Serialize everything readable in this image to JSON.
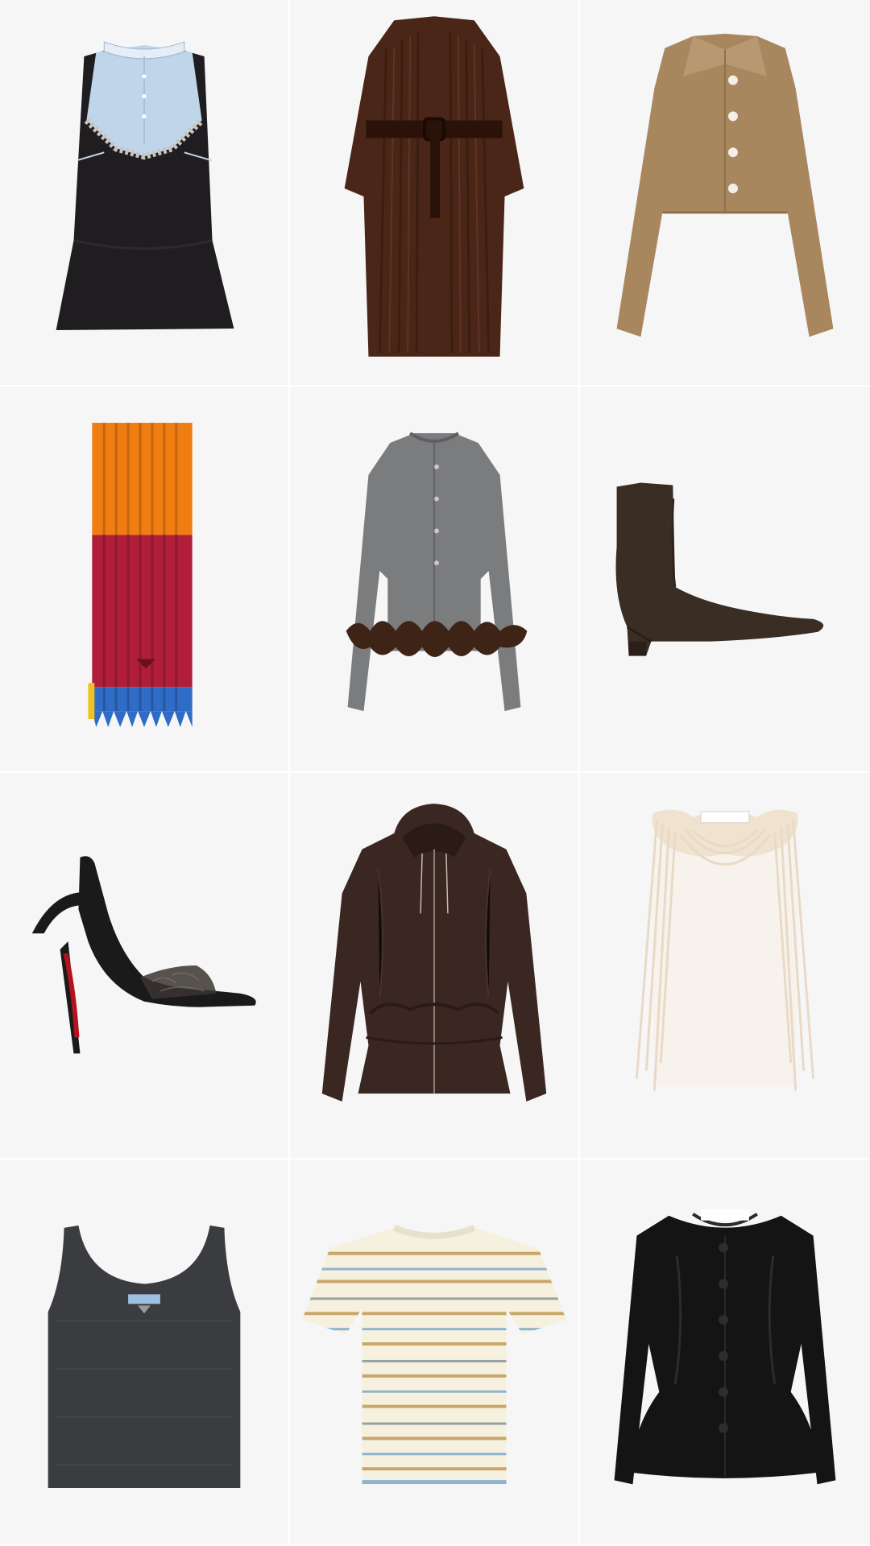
{
  "products": [
    {
      "name": "dress-icon",
      "kind": "dress"
    },
    {
      "name": "fur-coat-icon",
      "kind": "coat"
    },
    {
      "name": "cropped-jacket-icon",
      "kind": "jacket"
    },
    {
      "name": "knit-scarf-icon",
      "kind": "scarf"
    },
    {
      "name": "cardigan-icon",
      "kind": "cardigan"
    },
    {
      "name": "ankle-boot-icon",
      "kind": "boot"
    },
    {
      "name": "heeled-sandal-icon",
      "kind": "sandal"
    },
    {
      "name": "leather-hooded-jacket-icon",
      "kind": "hoodie"
    },
    {
      "name": "fringe-top-icon",
      "kind": "fringe-top"
    },
    {
      "name": "tank-top-icon",
      "kind": "tank"
    },
    {
      "name": "striped-tshirt-icon",
      "kind": "tshirt"
    },
    {
      "name": "leather-peplum-jacket-icon",
      "kind": "peplum-jacket"
    }
  ],
  "colors": {
    "tile_bg": "#f6f6f7",
    "divider": "#ffffff"
  }
}
